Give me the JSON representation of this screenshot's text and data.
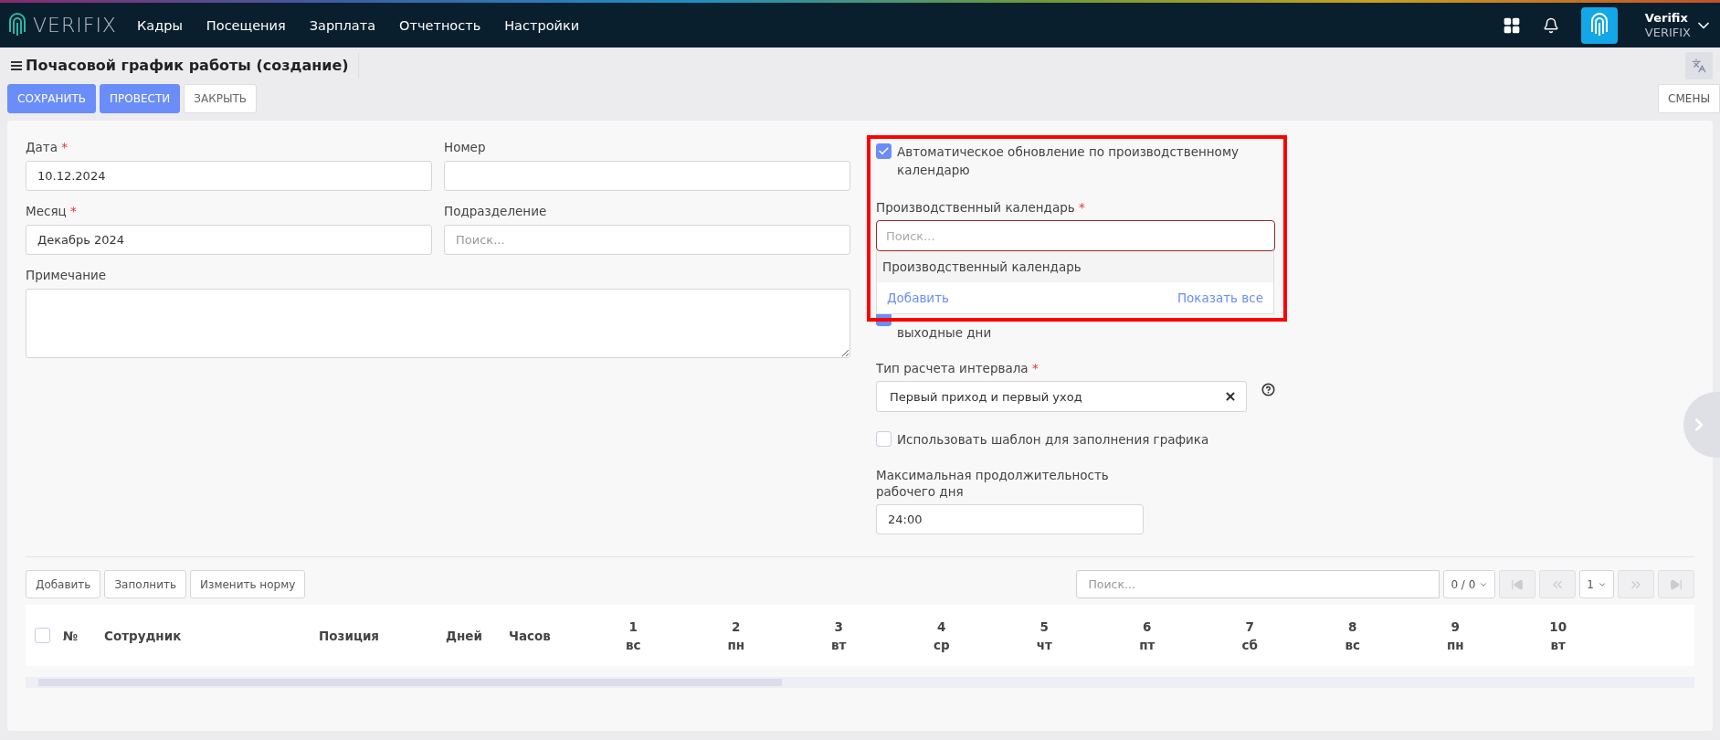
{
  "nav": {
    "brand": "VERIFIX",
    "menu": [
      "Кадры",
      "Посещения",
      "Зарплата",
      "Отчетность",
      "Настройки"
    ],
    "user_name": "Verifix",
    "company": "VERIFIX"
  },
  "page": {
    "title": "Почасовой график работы (создание)",
    "side_button": "СМЕНЫ",
    "actions": [
      {
        "label": "СОХРАНИТЬ",
        "kind": "primary"
      },
      {
        "label": "ПРОВЕСТИ",
        "kind": "primary"
      },
      {
        "label": "ЗАКРЫТЬ",
        "kind": "default"
      }
    ]
  },
  "form": {
    "fields": [
      {
        "label": "Дата",
        "required_mark": "*",
        "value": "10.12.2024"
      },
      {
        "label": "Номер"
      },
      {
        "label": "Месяц",
        "required_mark": "*",
        "value": "Декабрь 2024"
      },
      {
        "label": "Подразделение",
        "placeholder": "Поиск..."
      }
    ],
    "note": {
      "label": "Примечание"
    }
  },
  "settings": {
    "auto_update": {
      "label": "Автоматическое обновление по производственному календарю",
      "checked": true
    },
    "calendar": {
      "label": "Производственный календарь",
      "required_mark": "*",
      "placeholder": "Поиск...",
      "options": [
        "Производственный календарь"
      ],
      "add_link": "Добавить",
      "show_all_link": "Показать все"
    },
    "weekend": {
      "label": "выходные дни",
      "checked": true
    },
    "interval": {
      "label": "Тип расчета интервала",
      "required_mark": "*",
      "value": "Первый приход и первый уход"
    },
    "template": {
      "label": "Использовать шаблон для заполнения графика",
      "checked": false
    },
    "max_duration": {
      "label": "Максимальная продолжительность рабочего дня",
      "value": "24:00"
    }
  },
  "table": {
    "buttons": [
      "Добавить",
      "Заполнить",
      "Изменить норму"
    ],
    "search_placeholder": "Поиск...",
    "page_size": "0 / 0",
    "page": "1",
    "select_all_checked": false,
    "columns": [
      "№",
      "Сотрудник",
      "Позиция",
      "Дней",
      "Часов"
    ],
    "days": [
      {
        "num": "1",
        "weekday": "вс"
      },
      {
        "num": "2",
        "weekday": "пн"
      },
      {
        "num": "3",
        "weekday": "вт"
      },
      {
        "num": "4",
        "weekday": "ср"
      },
      {
        "num": "5",
        "weekday": "чт"
      },
      {
        "num": "6",
        "weekday": "пт"
      },
      {
        "num": "7",
        "weekday": "сб"
      },
      {
        "num": "8",
        "weekday": "вс"
      },
      {
        "num": "9",
        "weekday": "пн"
      },
      {
        "num": "10",
        "weekday": "вт"
      }
    ]
  }
}
